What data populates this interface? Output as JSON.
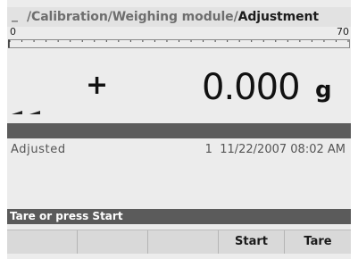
{
  "breadcrumb": {
    "leading": "_",
    "path": "/Calibration/Weighing module/",
    "current": "Adjustment"
  },
  "scale": {
    "min_label": "0",
    "max_label": "70"
  },
  "weight": {
    "sign": "+",
    "value": "0.000",
    "unit": "g"
  },
  "info": {
    "label": "Adjusted",
    "number": "1",
    "date": "11/22/2007",
    "time": "08:02 AM"
  },
  "message": "Tare or press Start",
  "softkeys": [
    "",
    "",
    "",
    "Start",
    "Tare"
  ],
  "colors": {
    "screen_bg": "#ececec",
    "bar_gray": "#5c5c5c",
    "title_text": "#6e6e6e",
    "title_active": "#1c1c1c"
  }
}
